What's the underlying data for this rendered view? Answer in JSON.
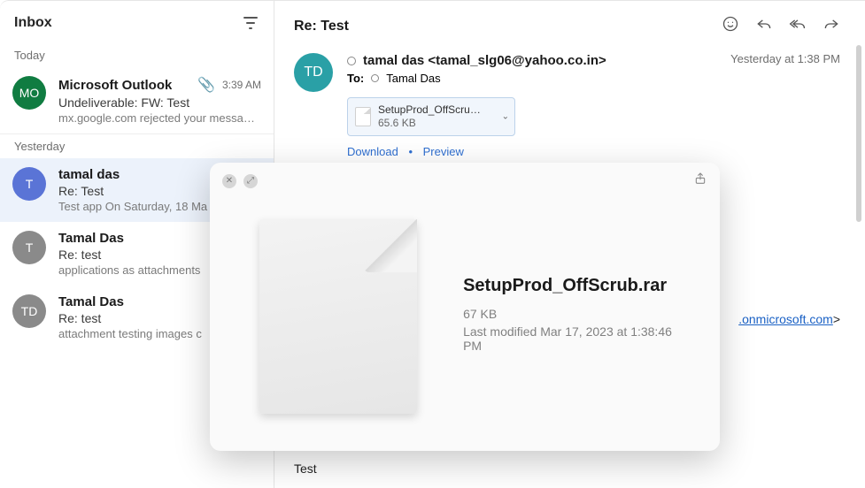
{
  "sidebar": {
    "title": "Inbox",
    "sections": [
      {
        "label": "Today",
        "messages": [
          {
            "from": "Microsoft Outlook",
            "avatar": "MO",
            "avatarColor": "#107c41",
            "subject": "Undeliverable: FW: Test",
            "preview": "mx.google.com rejected your messa…",
            "time": "3:39 AM",
            "hasAttachment": true,
            "selected": false
          }
        ]
      },
      {
        "label": "Yesterday",
        "messages": [
          {
            "from": "tamal das",
            "avatar": "T",
            "avatarColor": "#5a74d6",
            "subject": "Re: Test",
            "preview": "Test app On Saturday, 18 Ma",
            "time": "",
            "hasAttachment": false,
            "selected": true
          },
          {
            "from": "Tamal Das",
            "avatar": "T",
            "avatarColor": "#8a8a8a",
            "subject": "Re: test",
            "preview": "applications as attachments",
            "time": "",
            "hasAttachment": false,
            "selected": false
          },
          {
            "from": "Tamal Das",
            "avatar": "TD",
            "avatarColor": "#8a8a8a",
            "subject": "Re: test",
            "preview": "attachment testing images c",
            "time": "",
            "hasAttachment": false,
            "selected": false
          }
        ]
      }
    ]
  },
  "mail": {
    "subject": "Re: Test",
    "senderAvatar": "TD",
    "senderDisplay": "tamal das <tamal_slg06@yahoo.co.in>",
    "toLabel": "To:",
    "toName": "Tamal Das",
    "date": "Yesterday at 1:38 PM",
    "attachment": {
      "nameShort": "SetupProd_OffScrub…",
      "size": "65.6 KB"
    },
    "downloadLabel": "Download",
    "previewLabel": "Preview",
    "bodyLinkTail": ".onmicrosoft.com",
    "bodyBottom": "Test"
  },
  "quicklook": {
    "filename": "SetupProd_OffScrub.rar",
    "size": "67 KB",
    "modified": "Last modified Mar 17, 2023 at 1:38:46 PM"
  }
}
